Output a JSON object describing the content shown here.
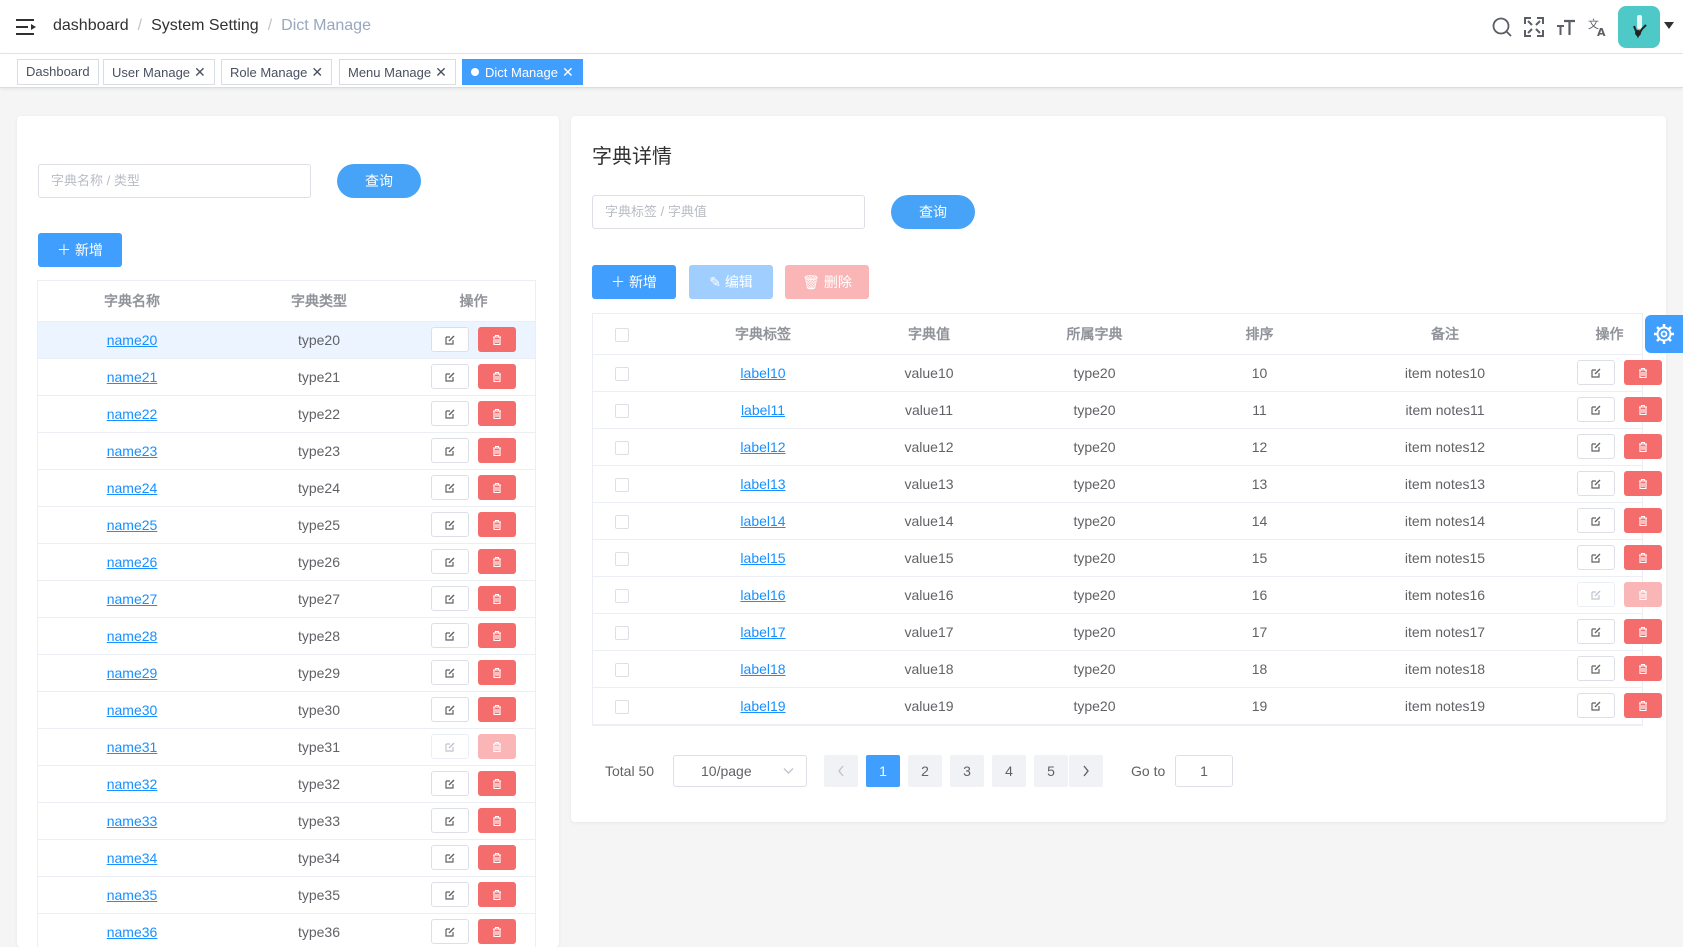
{
  "breadcrumb": [
    "dashboard",
    "System Setting",
    "Dict Manage"
  ],
  "tags": [
    {
      "label": "Dashboard",
      "closable": false
    },
    {
      "label": "User Manage",
      "closable": true
    },
    {
      "label": "Role Manage",
      "closable": true
    },
    {
      "label": "Menu Manage",
      "closable": true
    },
    {
      "label": "Dict Manage",
      "closable": true,
      "active": true
    }
  ],
  "close_glyph": "✕",
  "left": {
    "search_placeholder": "字典名称 / 类型",
    "search_button": "查询",
    "add_button": "新增",
    "columns": [
      "字典名称",
      "字典类型",
      "操作"
    ],
    "rows": [
      {
        "name": "name20",
        "type": "type20"
      },
      {
        "name": "name21",
        "type": "type21"
      },
      {
        "name": "name22",
        "type": "type22"
      },
      {
        "name": "name23",
        "type": "type23"
      },
      {
        "name": "name24",
        "type": "type24"
      },
      {
        "name": "name25",
        "type": "type25"
      },
      {
        "name": "name26",
        "type": "type26"
      },
      {
        "name": "name27",
        "type": "type27"
      },
      {
        "name": "name28",
        "type": "type28"
      },
      {
        "name": "name29",
        "type": "type29"
      },
      {
        "name": "name30",
        "type": "type30"
      },
      {
        "name": "name31",
        "type": "type31"
      },
      {
        "name": "name32",
        "type": "type32"
      },
      {
        "name": "name33",
        "type": "type33"
      },
      {
        "name": "name34",
        "type": "type34"
      },
      {
        "name": "name35",
        "type": "type35"
      },
      {
        "name": "name36",
        "type": "type36"
      }
    ]
  },
  "right": {
    "title": "字典详情",
    "search_placeholder": "字典标签 / 字典值",
    "search_button": "查询",
    "add_button": "新增",
    "edit_button": "编辑",
    "delete_button": "删除",
    "columns": [
      "字典标签",
      "字典值",
      "所属字典",
      "排序",
      "备注",
      "操作"
    ],
    "rows": [
      {
        "label": "label10",
        "value": "value10",
        "dict": "type20",
        "sort": "10",
        "notes": "item notes10"
      },
      {
        "label": "label11",
        "value": "value11",
        "dict": "type20",
        "sort": "11",
        "notes": "item notes11"
      },
      {
        "label": "label12",
        "value": "value12",
        "dict": "type20",
        "sort": "12",
        "notes": "item notes12"
      },
      {
        "label": "label13",
        "value": "value13",
        "dict": "type20",
        "sort": "13",
        "notes": "item notes13"
      },
      {
        "label": "label14",
        "value": "value14",
        "dict": "type20",
        "sort": "14",
        "notes": "item notes14"
      },
      {
        "label": "label15",
        "value": "value15",
        "dict": "type20",
        "sort": "15",
        "notes": "item notes15"
      },
      {
        "label": "label16",
        "value": "value16",
        "dict": "type20",
        "sort": "16",
        "notes": "item notes16"
      },
      {
        "label": "label17",
        "value": "value17",
        "dict": "type20",
        "sort": "17",
        "notes": "item notes17"
      },
      {
        "label": "label18",
        "value": "value18",
        "dict": "type20",
        "sort": "18",
        "notes": "item notes18"
      },
      {
        "label": "label19",
        "value": "value19",
        "dict": "type20",
        "sort": "19",
        "notes": "item notes19"
      }
    ],
    "pagination": {
      "total": "Total 50",
      "page_size": "10/page",
      "pages": [
        "1",
        "2",
        "3",
        "4",
        "5"
      ],
      "current": "1",
      "goto_label": "Go to",
      "goto_value": "1"
    }
  },
  "colors": {
    "primary": "#409eff",
    "danger": "#f56c6c",
    "link": "#1890ff",
    "avatar": "#4fc8c8"
  }
}
